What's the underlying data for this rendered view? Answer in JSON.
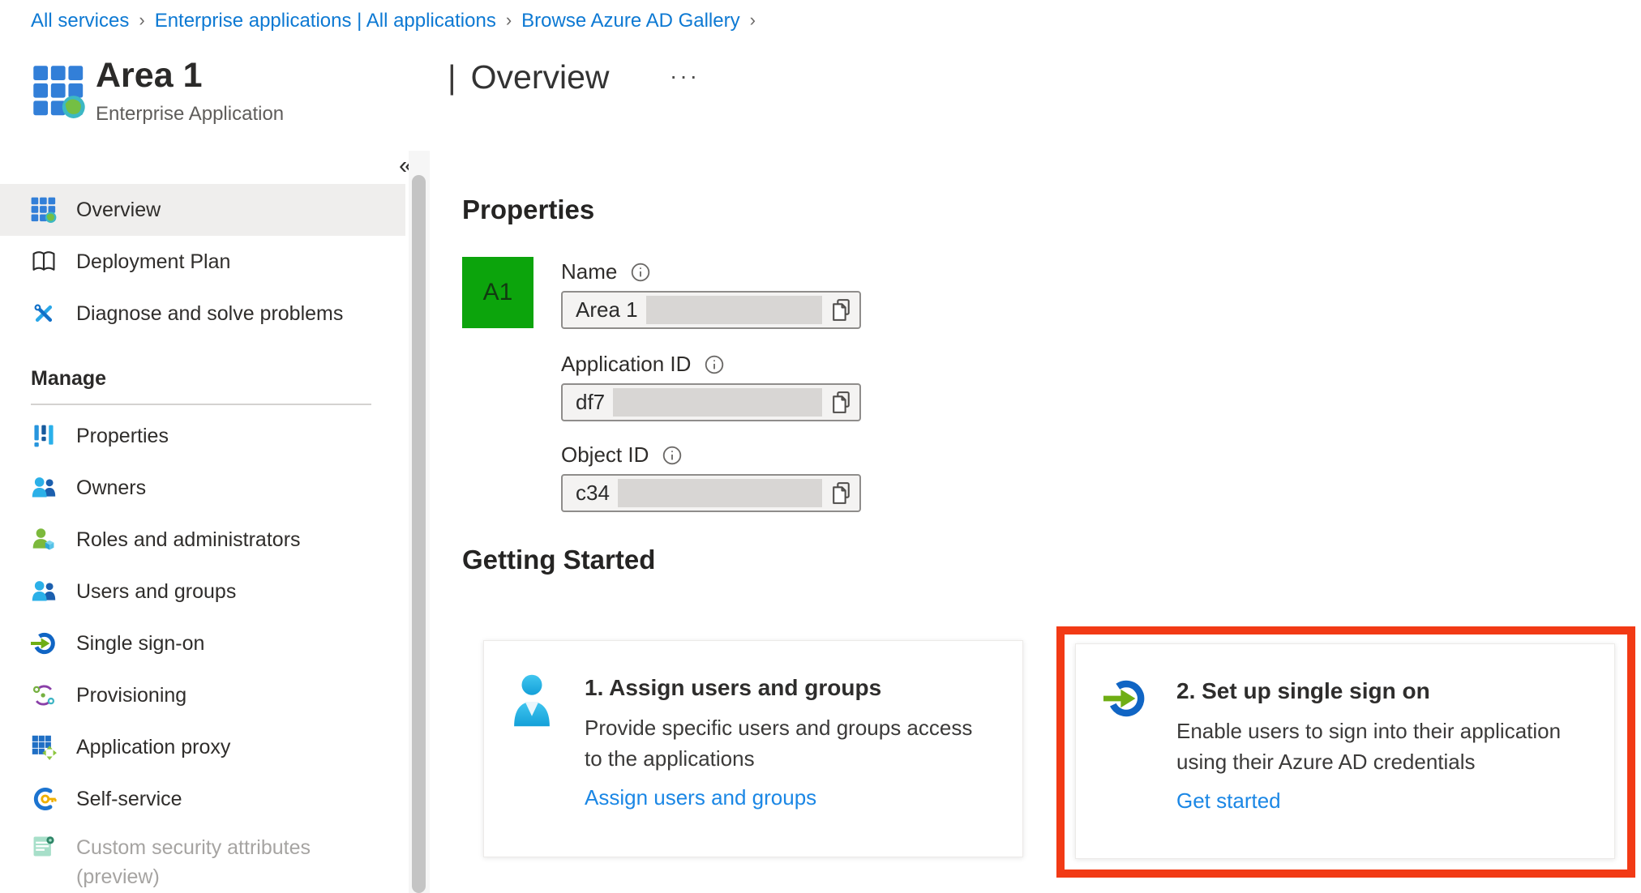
{
  "breadcrumb": {
    "separator": "›",
    "items": [
      {
        "label": "All services"
      },
      {
        "label": "Enterprise applications | All applications"
      },
      {
        "label": "Browse Azure AD Gallery"
      }
    ]
  },
  "header": {
    "title": "Area 1",
    "subtitle": "Enterprise Application",
    "separator": "|",
    "section": "Overview",
    "more": "···",
    "collapse": "«"
  },
  "sidebar": {
    "items": [
      {
        "label": "Overview",
        "icon": "app-grid-globe-icon",
        "selected": true
      },
      {
        "label": "Deployment Plan",
        "icon": "book-icon",
        "selected": false
      },
      {
        "label": "Diagnose and solve problems",
        "icon": "tools-icon",
        "selected": false
      }
    ],
    "manage": {
      "header": "Manage",
      "items": [
        {
          "label": "Properties",
          "icon": "sliders-icon"
        },
        {
          "label": "Owners",
          "icon": "people-icon"
        },
        {
          "label": "Roles and administrators",
          "icon": "person-cube-icon"
        },
        {
          "label": "Users and groups",
          "icon": "people-icon"
        },
        {
          "label": "Single sign-on",
          "icon": "sso-icon"
        },
        {
          "label": "Provisioning",
          "icon": "sync-icon"
        },
        {
          "label": "Application proxy",
          "icon": "grid-arrows-icon"
        },
        {
          "label": "Self-service",
          "icon": "ring-key-icon"
        },
        {
          "label": "Custom security attributes (preview)",
          "icon": "document-gear-icon",
          "disabled": true
        }
      ]
    }
  },
  "main": {
    "properties": {
      "heading": "Properties",
      "avatar": {
        "text": "A1",
        "color": "#0ca40c"
      },
      "fields": [
        {
          "label": "Name",
          "value": "Area 1",
          "redacted": true
        },
        {
          "label": "Application ID",
          "value": "df7",
          "redacted": true
        },
        {
          "label": "Object ID",
          "value": "c34",
          "redacted": true
        }
      ]
    },
    "getting_started": {
      "heading": "Getting Started",
      "cards": [
        {
          "title": "1. Assign users and groups",
          "description": "Provide specific users and groups access to the applications",
          "link": "Assign users and groups",
          "icon": "person-icon",
          "highlighted": false
        },
        {
          "title": "2. Set up single sign on",
          "description": "Enable users to sign into their application using their Azure AD credentials",
          "link": "Get started",
          "icon": "sso-arrow-icon",
          "highlighted": true
        }
      ]
    }
  },
  "colors": {
    "link_blue": "#0d79d3",
    "card_link_blue": "#1b87e5",
    "highlight_red": "#f23a15",
    "avatar_green": "#0ca40c",
    "selected_row_gray": "#efeeed",
    "redaction_gray": "#d8d6d4"
  }
}
